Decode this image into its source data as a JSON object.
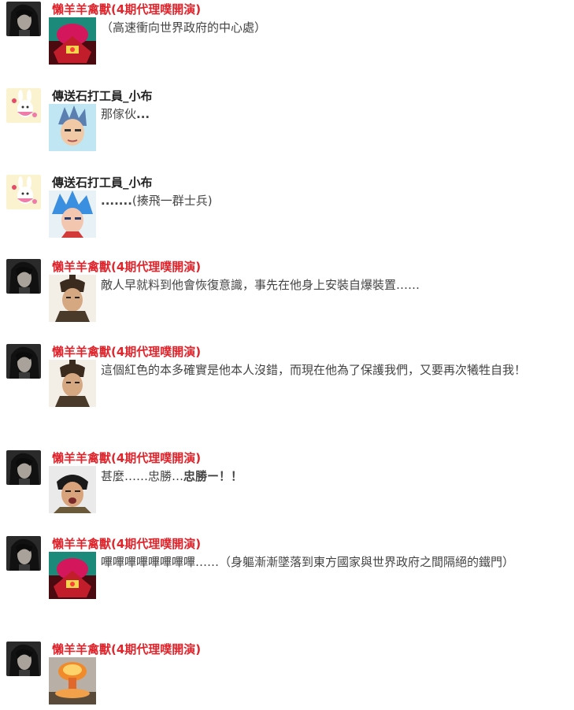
{
  "posts": [
    {
      "author": "懶羊羊禽獸(4期代理噗開演)",
      "author_color": "#e0242c",
      "avatar_icon": "dark-hair-man-avatar",
      "sticker_icon": "red-mecha-sticker",
      "message": "（高速衝向世界政府的中心處）",
      "bold_tail": ""
    },
    {
      "author": "傳送石打工員_小布",
      "author_color": "#222222",
      "avatar_icon": "pink-bunny-avatar",
      "sticker_icon": "vegeta-face-sticker",
      "message": "那傢伙",
      "bold_tail": "..."
    },
    {
      "author": "傳送石打工員_小布",
      "author_color": "#222222",
      "avatar_icon": "pink-bunny-avatar",
      "sticker_icon": "goku-blue-sticker",
      "message": "",
      "bold_tail_lead": ".......",
      "message_tail": "(揍飛一群士兵)"
    },
    {
      "author": "懶羊羊禽獸(4期代理噗開演)",
      "author_color": "#e0242c",
      "avatar_icon": "dark-hair-man-avatar",
      "sticker_icon": "warrior-topknot-sticker",
      "message": "敵人早就料到他會恢復意識，事先在他身上安裝自爆裝置……",
      "bold_tail": ""
    },
    {
      "author": "懶羊羊禽獸(4期代理噗開演)",
      "author_color": "#e0242c",
      "avatar_icon": "dark-hair-man-avatar",
      "sticker_icon": "warrior-topknot-sticker",
      "message": "這個紅色的本多確實是他本人沒錯，而現在他為了保護我們，又要再次犧牲自我！",
      "bold_tail": ""
    },
    {
      "author": "懶羊羊禽獸(4期代理噗開演)",
      "author_color": "#e0242c",
      "avatar_icon": "dark-hair-man-avatar",
      "sticker_icon": "shouting-warrior-sticker",
      "message": "甚麼……忠勝…",
      "bold_tail": "忠勝ー！！"
    },
    {
      "author": "懶羊羊禽獸(4期代理噗開演)",
      "author_color": "#e0242c",
      "avatar_icon": "dark-hair-man-avatar",
      "sticker_icon": "red-mecha-sticker",
      "message": "嗶嗶嗶嗶嗶嗶嗶嗶……（身軀漸漸墜落到東方國家與世界政府之間隔絕的鐵門）",
      "bold_tail": ""
    },
    {
      "author": "懶羊羊禽獸(4期代理噗開演)",
      "author_color": "#e0242c",
      "avatar_icon": "dark-hair-man-avatar",
      "sticker_icon": "explosion-sticker",
      "message": "",
      "bold_tail": ""
    }
  ]
}
